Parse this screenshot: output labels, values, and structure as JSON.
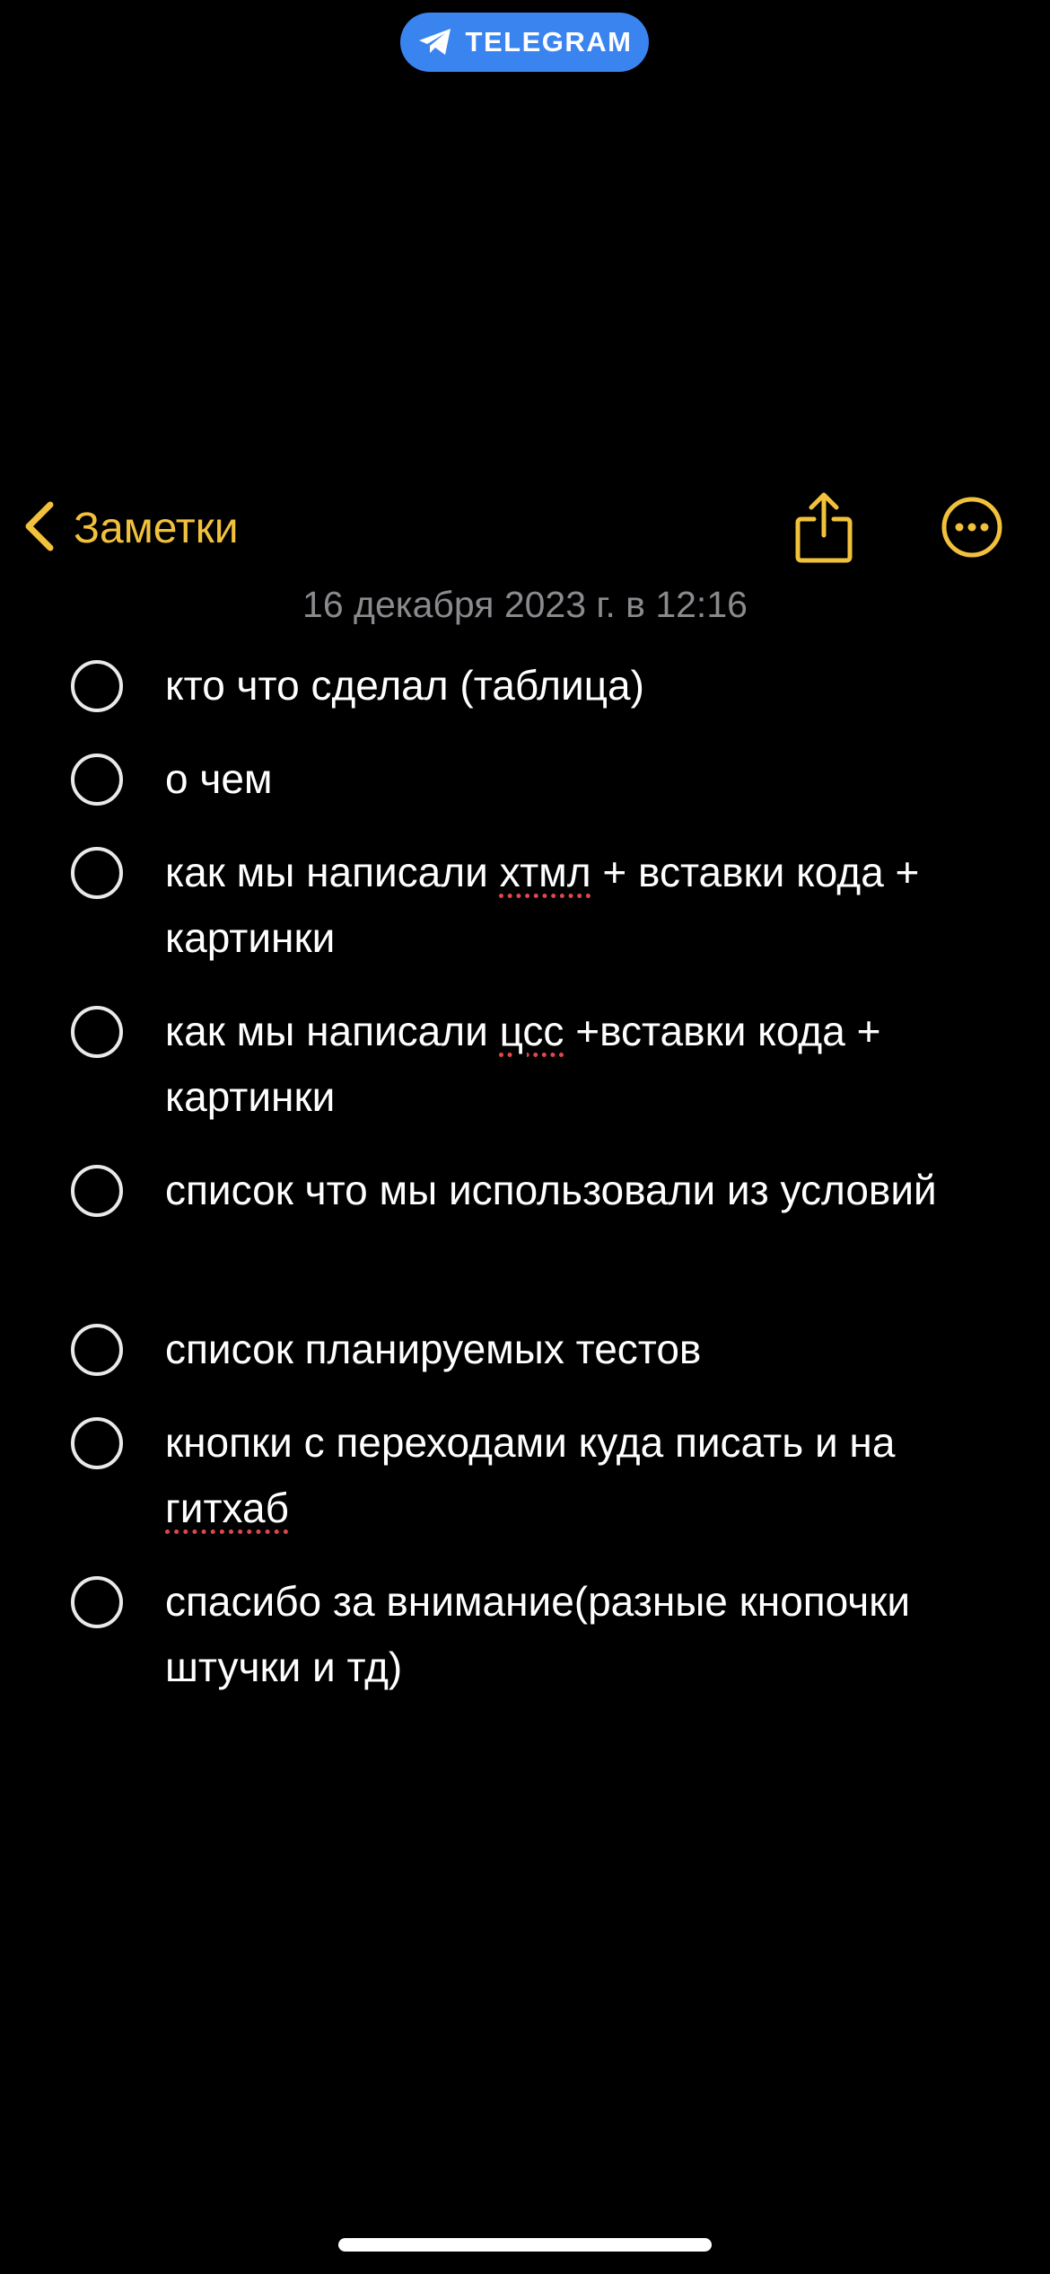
{
  "banner": {
    "label": "TELEGRAM",
    "color": "#3a84f0",
    "icon": "paper-plane-icon"
  },
  "nav": {
    "back_label": "Заметки",
    "accent_color": "#f2c13c",
    "back_icon": "chevron-left-icon",
    "share_icon": "share-icon",
    "more_icon": "ellipsis-circle-icon"
  },
  "note": {
    "date": "16 декабря 2023 г. в 12:16",
    "items": [
      {
        "checked": false,
        "parts": [
          "кто что сделал (таблица)"
        ]
      },
      {
        "checked": false,
        "parts": [
          "о чем"
        ]
      },
      {
        "checked": false,
        "parts": [
          "как мы написали ",
          "хтмл",
          " + вставки кода + картинки"
        ]
      },
      {
        "checked": false,
        "parts": [
          "как мы написали ",
          "цсс",
          " +вставки кода + картинки"
        ]
      },
      {
        "checked": false,
        "parts": [
          "список что мы использовали из условий"
        ]
      },
      {
        "checked": false,
        "parts": [
          "список планируемых тестов"
        ]
      },
      {
        "checked": false,
        "parts": [
          "кнопки с переходами куда писать и на ",
          "гитхаб"
        ]
      },
      {
        "checked": false,
        "parts": [
          "спасибо за внимание(разные кнопочки штучки и тд)"
        ]
      }
    ]
  }
}
